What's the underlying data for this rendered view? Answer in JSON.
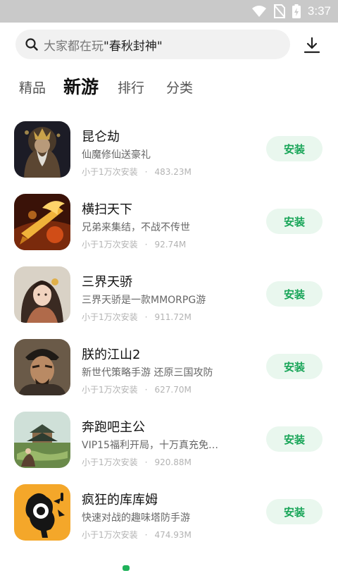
{
  "status_bar": {
    "time": "3:37"
  },
  "search": {
    "prefix": "大家都在玩",
    "highlight": "\"春秋封神\""
  },
  "tabs": [
    {
      "label": "精品",
      "active": false
    },
    {
      "label": "新游",
      "active": true
    },
    {
      "label": "排行",
      "active": false
    },
    {
      "label": "分类",
      "active": false
    }
  ],
  "install_label": "安装",
  "dot": "·",
  "apps": [
    {
      "name": "昆仑劫",
      "desc": "仙魔修仙送豪礼",
      "installs": "小于1万次安装",
      "size": "483.23M"
    },
    {
      "name": "横扫天下",
      "desc": "兄弟来集结，不战不传世",
      "installs": "小于1万次安装",
      "size": "92.74M"
    },
    {
      "name": "三界天骄",
      "desc": "三界天骄是一款MMORPG游",
      "installs": "小于1万次安装",
      "size": "911.72M"
    },
    {
      "name": "朕的江山2",
      "desc": "新世代策略手游 还原三国攻防",
      "installs": "小于1万次安装",
      "size": "627.70M"
    },
    {
      "name": "奔跑吧主公",
      "desc": "VIP15福利开局，十万真充免…",
      "installs": "小于1万次安装",
      "size": "920.88M"
    },
    {
      "name": "疯狂的库库姆",
      "desc": "快速对战的趣味塔防手游",
      "installs": "小于1万次安装",
      "size": "474.93M"
    }
  ],
  "colors": {
    "accent": "#18a558",
    "install_bg": "#e9f7ee",
    "status_bar": "#c9c9c9"
  }
}
